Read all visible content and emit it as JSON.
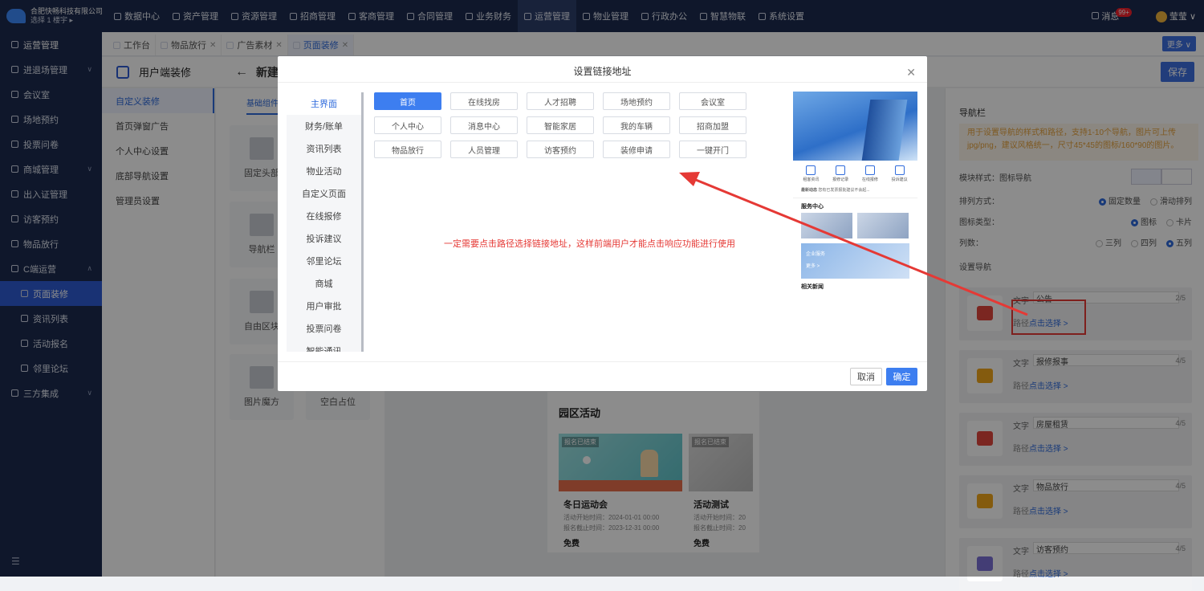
{
  "company": {
    "name": "合肥快畅科技有限公司",
    "building": "选择 1 楼宇 ▸"
  },
  "topnav": [
    "数据中心",
    "资产管理",
    "资源管理",
    "招商管理",
    "客商管理",
    "合同管理",
    "业务财务",
    "运营管理",
    "物业管理",
    "行政办公",
    "智慧物联",
    "系统设置"
  ],
  "topnav_active": "运营管理",
  "user": {
    "messages": "消息",
    "badge": "99+",
    "name": "莹莹"
  },
  "sidebar": {
    "items": [
      {
        "label": "运营管理",
        "kind": "head"
      },
      {
        "label": "进退场管理",
        "kind": "group"
      },
      {
        "label": "会议室",
        "kind": "item"
      },
      {
        "label": "场地预约",
        "kind": "item"
      },
      {
        "label": "投票问卷",
        "kind": "item"
      },
      {
        "label": "商城管理",
        "kind": "group"
      },
      {
        "label": "出入证管理",
        "kind": "item"
      },
      {
        "label": "访客预约",
        "kind": "item"
      },
      {
        "label": "物品放行",
        "kind": "item"
      },
      {
        "label": "C端运营",
        "kind": "group-open"
      },
      {
        "label": "页面装修",
        "kind": "sub-active"
      },
      {
        "label": "资讯列表",
        "kind": "sub"
      },
      {
        "label": "活动报名",
        "kind": "sub"
      },
      {
        "label": "邻里论坛",
        "kind": "sub"
      },
      {
        "label": "三方集成",
        "kind": "group"
      }
    ],
    "collapse_icon": "menu-collapse-icon"
  },
  "tabs": [
    {
      "label": "工作台",
      "closable": false
    },
    {
      "label": "物品放行",
      "closable": true
    },
    {
      "label": "广告素材",
      "closable": true
    },
    {
      "label": "页面装修",
      "closable": true,
      "active": true
    }
  ],
  "more_label": "更多 ∨",
  "page": {
    "title": "用户端装修",
    "subtitle": "新建页面",
    "save": "保存"
  },
  "left_menu": [
    "自定义装修",
    "首页弹窗广告",
    "个人中心设置",
    "底部导航设置",
    "管理员设置"
  ],
  "left_menu_active": "自定义装修",
  "components": {
    "tab": "基础组件",
    "items": [
      "固定头部",
      "导航栏",
      "自由区块",
      "图片魔方",
      "空白占位"
    ]
  },
  "canvas": {
    "section_title": "园区活动",
    "cards": [
      {
        "tag": "报名已结束",
        "title": "冬日运动会",
        "start": "活动开始时间：2024-01-01 00:00",
        "end": "报名截止时间：2023-12-31 00:00",
        "fee": "免费"
      },
      {
        "tag": "报名已结束",
        "title": "活动测试",
        "start": "活动开始时间：20",
        "end": "报名截止时间：20",
        "fee": "免费"
      }
    ]
  },
  "right_panel": {
    "title": "导航栏",
    "hint": "用于设置导航的样式和路径，支持1-10个导航，图片可上传jpg/png，建议风格统一，尺寸45*45的图标/160*90的图片。",
    "style_label": "模块样式：图标导航",
    "arrange_label": "排列方式：",
    "arrange_opts": [
      "固定数量",
      "滑动排列"
    ],
    "icon_type_label": "图标类型：",
    "icon_type_opts": [
      "图标",
      "卡片"
    ],
    "columns_label": "列数：",
    "columns_opts": [
      "三列",
      "四列",
      "五列"
    ],
    "setting_label": "设置导航",
    "text_label": "文字",
    "path_label": "路径",
    "pick_label": "点击选择 >",
    "navs": [
      {
        "text": "公告",
        "count": "2/5",
        "icon": "megaphone-icon",
        "color": "#e0463c"
      },
      {
        "text": "报修报事",
        "count": "4/5",
        "icon": "house-repair-icon",
        "color": "#f0a71a"
      },
      {
        "text": "房屋租赁",
        "count": "4/5",
        "icon": "house-rent-icon",
        "color": "#e0463c"
      },
      {
        "text": "物品放行",
        "count": "4/5",
        "icon": "package-icon",
        "color": "#f0a71a"
      },
      {
        "text": "访客预约",
        "count": "4/5",
        "icon": "clock-icon",
        "color": "#7b6fd6"
      }
    ]
  },
  "dialog": {
    "title": "设置链接地址",
    "categories": [
      "主界面",
      "财务/账单",
      "资讯列表",
      "物业活动",
      "自定义页面",
      "在线报修",
      "投诉建议",
      "邻里论坛",
      "商城",
      "用户审批",
      "投票问卷",
      "智能通讯"
    ],
    "category_active": "主界面",
    "links": [
      "首页",
      "在线找房",
      "人才招聘",
      "场地预约",
      "会议室",
      "个人中心",
      "消息中心",
      "智能家居",
      "我的车辆",
      "招商加盟",
      "物品放行",
      "人员管理",
      "访客预约",
      "装修申请",
      "一键开门"
    ],
    "link_active": "首页",
    "annotation": "一定需要点击路径选择链接地址，这样前端用户才能点击响应功能进行使用",
    "preview": {
      "icons": [
        "租客资讯",
        "报修记录",
        "在线报修",
        "投诉建议"
      ],
      "news_label": "最新动态",
      "news_text": "您有已发票报批建议不会起...",
      "service_title": "服务中心",
      "banner_title": "企业服务",
      "banner_btn": "更多 >",
      "related_title": "相关新闻"
    },
    "cancel": "取消",
    "ok": "确定"
  },
  "colors": {
    "primary": "#3d7ef0",
    "navbg": "#1d2b4f",
    "annotation": "#e53935"
  }
}
